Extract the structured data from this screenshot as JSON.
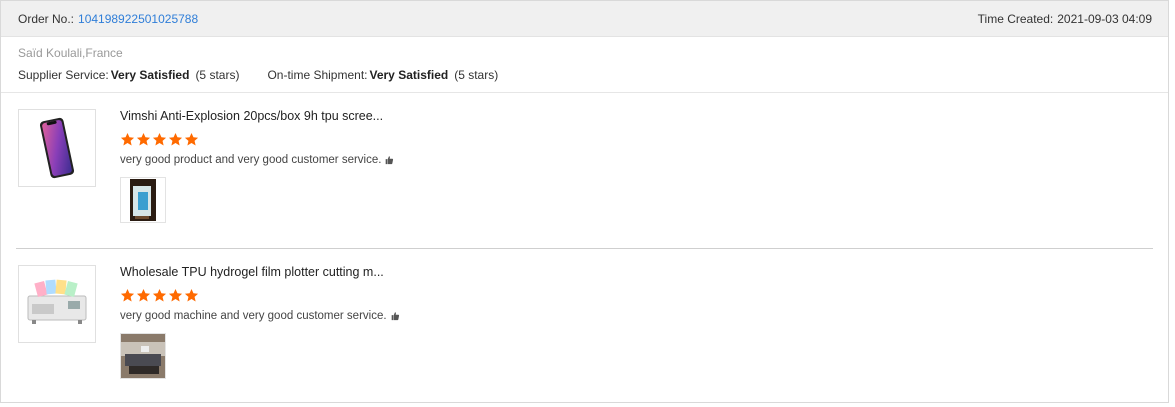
{
  "header": {
    "order_label": "Order No.:",
    "order_number": "104198922501025788",
    "time_label": "Time Created:",
    "time_value": "2021-09-03 04:09"
  },
  "buyer": {
    "name": "Saïd Koulali,France",
    "supplier_service_label": "Supplier Service:",
    "supplier_service_value": "Very Satisfied",
    "supplier_service_stars": "(5 stars)",
    "shipment_label": "On-time Shipment:",
    "shipment_value": "Very Satisfied",
    "shipment_stars": "(5 stars)"
  },
  "items": [
    {
      "title": "Vimshi Anti-Explosion 20pcs/box 9h tpu scree...",
      "rating": 5,
      "comment": "very good product and very good customer service.",
      "thumb_icon": "smartphone-icon",
      "photo_icon": "phone-screen-photo-icon"
    },
    {
      "title": "Wholesale TPU hydrogel film plotter cutting m...",
      "rating": 5,
      "comment": "very good machine and very good customer service.",
      "thumb_icon": "cutting-machine-icon",
      "photo_icon": "machine-photo-icon"
    }
  ],
  "colors": {
    "link": "#2f7ed8",
    "star": "#ff6a00",
    "header_bg": "#f0f0f0"
  }
}
